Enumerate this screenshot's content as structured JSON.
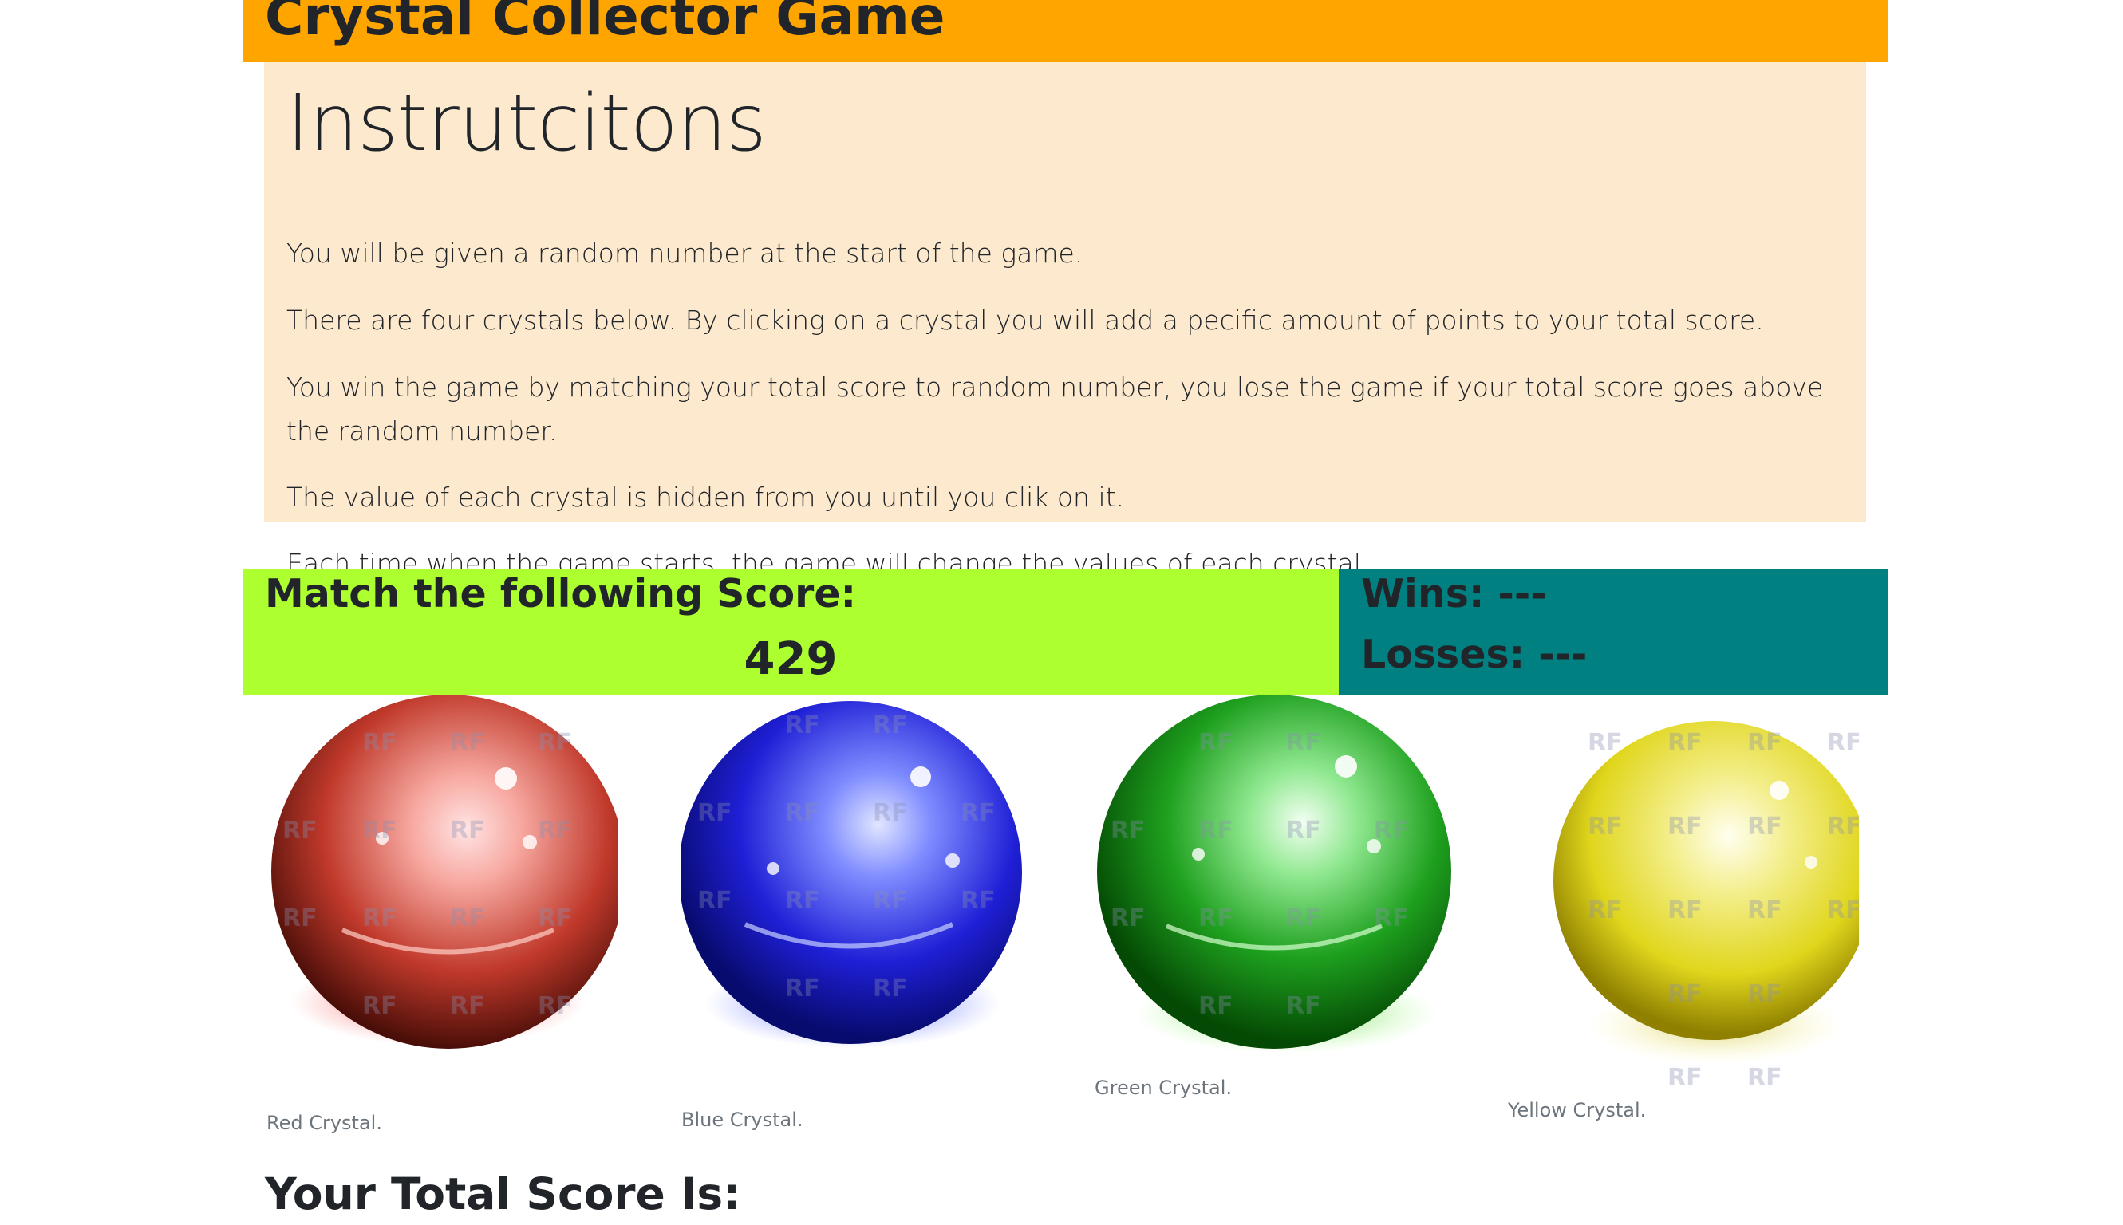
{
  "header": {
    "title": "Crystal Collector Game"
  },
  "instructions": {
    "heading": "Instrutcitons",
    "paragraphs": [
      "You will be given a random number at the start of the game.",
      "There are four crystals below. By clicking on a crystal you will add a pecific amount of points to your total score.",
      "You win the game by matching your total score to random number, you lose the game if your total score goes above the random number.",
      "The value of each crystal is hidden from you until you clik on it.",
      "Each time when the game starts, the game will change the values of each crystal."
    ]
  },
  "target": {
    "label": "Match the following Score:",
    "number": "429"
  },
  "stats": {
    "wins": "Wins: ---",
    "losses": "Losses: ---"
  },
  "crystals": [
    {
      "caption": "Red Crystal.",
      "color": "#c0392b"
    },
    {
      "caption": "Blue Crystal.",
      "color": "#1f1fd6"
    },
    {
      "caption": "Green Crystal.",
      "color": "#1ea01e"
    },
    {
      "caption": "Yellow Crystal.",
      "color": "#e0d61c"
    }
  ],
  "total": {
    "label": "Your Total Score Is:"
  },
  "colors": {
    "header": "#ffa500",
    "instructions_bg": "#fdeace",
    "target_bg": "#adff2f",
    "stats_bg": "#008080"
  },
  "icons": [
    "red-crystal-image",
    "blue-crystal-image",
    "green-crystal-image",
    "yellow-crystal-image"
  ]
}
